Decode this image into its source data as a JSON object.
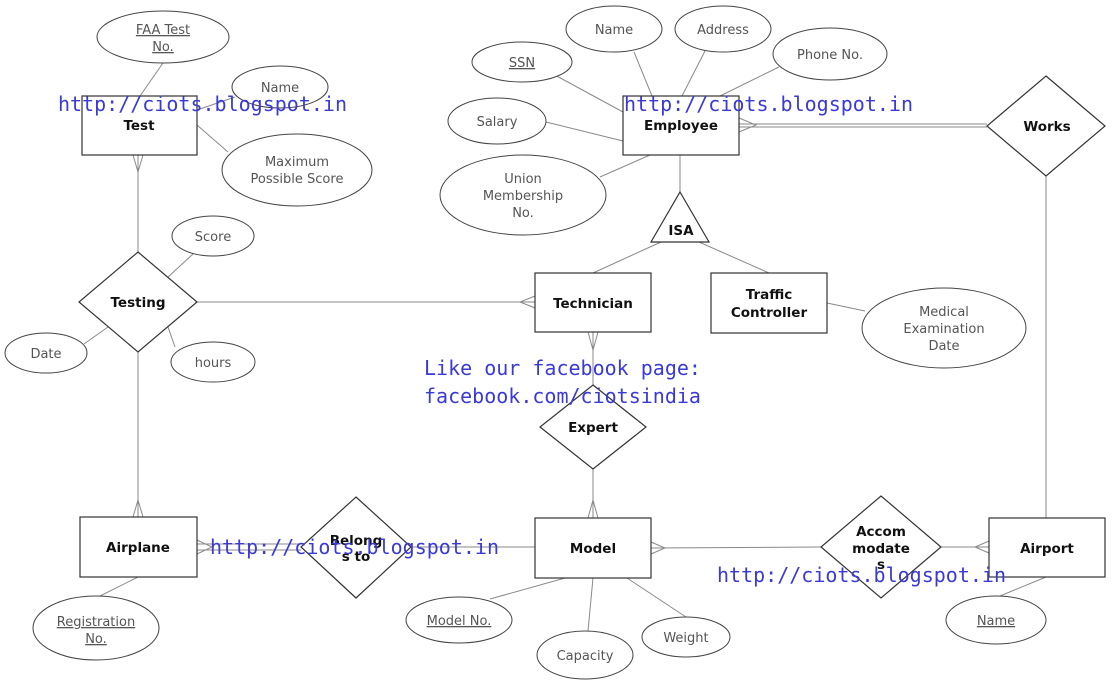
{
  "entities": {
    "test": "Test",
    "employee": "Employee",
    "technician": "Technician",
    "traffic_controller": [
      "Traffic",
      "Controller"
    ],
    "airplane": "Airplane",
    "model": "Model",
    "airport": "Airport"
  },
  "relationships": {
    "testing": "Testing",
    "works": "Works",
    "isa": "ISA",
    "expert": "Expert",
    "belongs_to": [
      "Belong",
      "s to"
    ],
    "accommodates": [
      "Accom",
      "modate",
      "s"
    ]
  },
  "attributes": {
    "faa_test_no": [
      "FAA Test",
      "No."
    ],
    "test_name": "Name",
    "max_score": [
      "Maximum",
      "Possible Score"
    ],
    "score": "Score",
    "date": "Date",
    "hours": "hours",
    "ssn": "SSN",
    "emp_name": "Name",
    "address": "Address",
    "phone": "Phone No.",
    "salary": "Salary",
    "union": [
      "Union",
      "Membership",
      "No."
    ],
    "medical": [
      "Medical",
      "Examination",
      "Date"
    ],
    "registration": [
      "Registration",
      "No."
    ],
    "model_no": "Model No.",
    "capacity": "Capacity",
    "weight": "Weight",
    "airport_name": "Name"
  },
  "watermarks": {
    "blog_url": "http://ciots.blogspot.in",
    "facebook_line1": "Like our facebook page:",
    "facebook_line2": "facebook.com/ciotsindia"
  },
  "colors": {
    "watermark": "#3a3ad6"
  }
}
